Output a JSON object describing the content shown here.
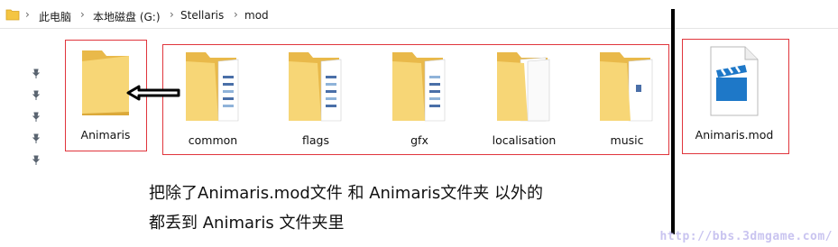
{
  "breadcrumb": [
    "此电脑",
    "本地磁盘 (G:)",
    "Stellaris",
    "mod"
  ],
  "folders": {
    "animaris": "Animaris",
    "common": "common",
    "flags": "flags",
    "gfx": "gfx",
    "localisation": "localisation",
    "music": "music"
  },
  "files": {
    "animaris_mod": "Animaris.mod"
  },
  "instruction": {
    "line1": "把除了Animaris.mod文件 和 Animaris文件夹 以外的",
    "line2": "都丢到 Animaris 文件夹里"
  },
  "watermark": "http://bbs.3dmgame.com/",
  "colors": {
    "highlight_box": "#e0353c",
    "folder_yellow": "#f7d676",
    "mod_icon_blue": "#1e78c8"
  }
}
